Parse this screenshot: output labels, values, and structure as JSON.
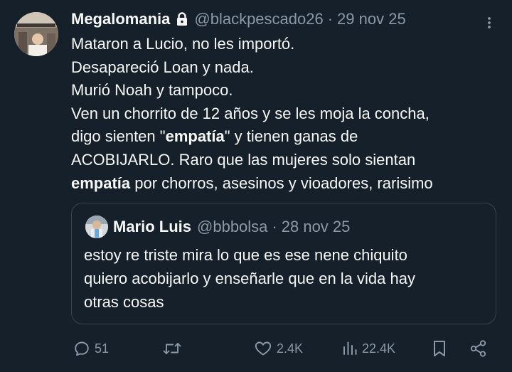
{
  "tweet": {
    "display_name": "Megalomania",
    "handle": "@blackpescado26",
    "separator": "·",
    "date": "29 nov 25",
    "lines": {
      "l1": "Mataron a Lucio, no les importó.",
      "l2": "Desapareció Loan y nada.",
      "l3": "Murió Noah y tampoco.",
      "l4": "Ven un chorrito de 12 años y se les moja la concha,",
      "l5_a": "digo sienten \"",
      "l5_bold": "empatía",
      "l5_b": "\" y tienen ganas de",
      "l6": "ACOBIJARLO. Raro que las mujeres solo sientan",
      "l7_bold": "empatía",
      "l7_b": " por chorros, asesinos y vioadores, rarisimo"
    }
  },
  "quote": {
    "display_name": "Mario Luis",
    "handle": "@bbbolsa",
    "separator": "·",
    "date": "28 nov 25",
    "lines": {
      "l1": "estoy re triste mira lo que es ese nene chiquito",
      "l2": "quiero acobijarlo y enseñarle que en la vida hay",
      "l3": "otras cosas"
    }
  },
  "actions": {
    "replies": "51",
    "retweets": "",
    "likes": "2.4K",
    "views": "22.4K"
  },
  "icons": {
    "lock": "lock-icon",
    "more": "more-vertical-icon",
    "reply": "reply-icon",
    "retweet": "retweet-icon",
    "like": "heart-icon",
    "views": "views-icon",
    "bookmark": "bookmark-icon",
    "share": "share-icon"
  },
  "colors": {
    "background": "#15202b",
    "text": "#f7f9f9",
    "secondary": "#8b98a5",
    "border": "#38444d"
  }
}
